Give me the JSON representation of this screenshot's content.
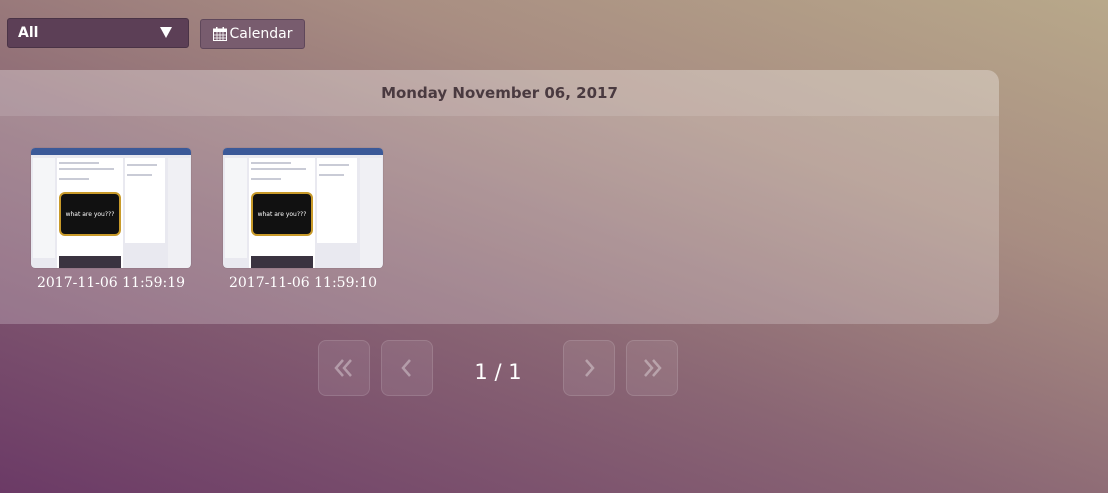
{
  "filter": {
    "selected": "All"
  },
  "calendar_button": {
    "label": "Calendar",
    "icon": "calendar-icon"
  },
  "group": {
    "date_header": "Monday November 06, 2017",
    "screenshots": [
      {
        "timestamp": "2017-11-06 11:59:19",
        "caption": "what are you???"
      },
      {
        "timestamp": "2017-11-06 11:59:10",
        "caption": "what are you???"
      }
    ]
  },
  "pagination": {
    "indicator": "1 / 1",
    "current_page": 1,
    "total_pages": 1,
    "icons": [
      "first-page-icon",
      "previous-page-icon",
      "next-page-icon",
      "last-page-icon"
    ]
  },
  "colors": {
    "background_start": "#6b3a66",
    "background_end": "#b8a88a",
    "select_bg": "#5c3f56",
    "button_bg": "#785c6e",
    "header_text": "#4a3a40"
  }
}
